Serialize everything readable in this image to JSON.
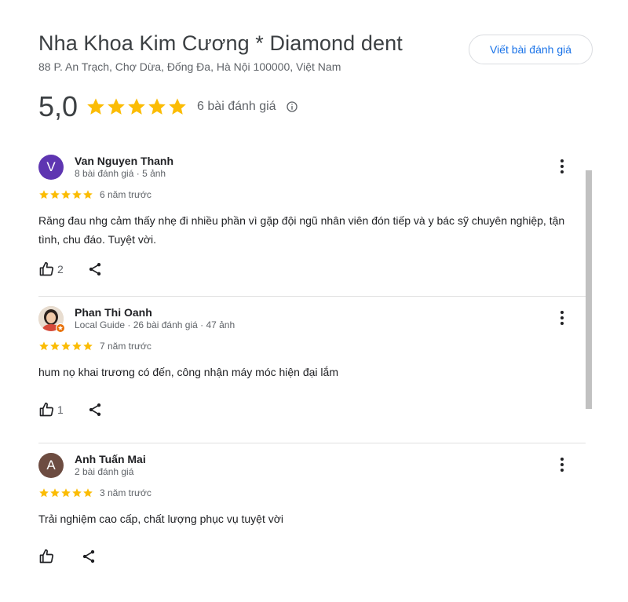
{
  "place": {
    "name": "Nha Khoa Kim Cương * Diamond dent",
    "address": "88 P. An Trạch, Chợ Dừa, Đống Đa, Hà Nội 100000, Việt Nam",
    "write_review_label": "Viết bài đánh giá"
  },
  "summary": {
    "rating": "5,0",
    "stars": 5,
    "review_count": "6 bài đánh giá"
  },
  "colors": {
    "star": "#fbbc04",
    "link": "#1a73e8",
    "avatar_v": "#5e35b1",
    "avatar_a": "#6d4c41",
    "guide_badge": "#e8710a"
  },
  "reviews": [
    {
      "name": "Van Nguyen Thanh",
      "avatar_letter": "V",
      "meta": "8 bài đánh giá · 5 ảnh",
      "stars": 5,
      "time": "6 năm trước",
      "text": "Răng đau nhg cảm thấy nhẹ đi nhiều phần vì gặp đội ngũ nhân viên đón tiếp và y bác sỹ chuyên nghiệp, tận tình, chu đáo. Tuyệt vời.",
      "likes": "2"
    },
    {
      "name": "Phan Thi Oanh",
      "avatar_letter": "",
      "meta": "Local Guide · 26 bài đánh giá · 47 ảnh",
      "stars": 5,
      "time": "7 năm trước",
      "text": "hum nọ khai trương có đến, công nhận máy móc hiện đại lắm",
      "likes": "1"
    },
    {
      "name": "Anh Tuấn Mai",
      "avatar_letter": "A",
      "meta": "2 bài đánh giá",
      "stars": 5,
      "time": "3 năm trước",
      "text": "Trải nghiệm cao cấp, chất lượng phục vụ tuyệt vời",
      "likes": ""
    }
  ],
  "icons": {
    "star": "star-icon",
    "info": "info-icon",
    "more": "more-vert-icon",
    "like": "thumb-up-icon",
    "share": "share-icon"
  }
}
